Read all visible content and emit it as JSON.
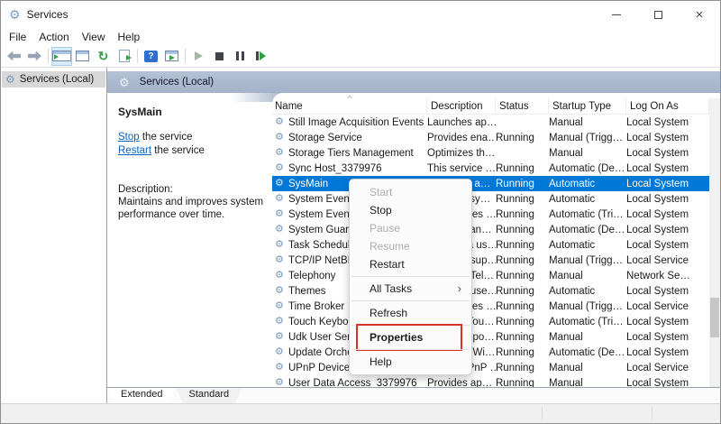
{
  "window": {
    "title": "Services"
  },
  "menubar": {
    "items": [
      "File",
      "Action",
      "View",
      "Help"
    ]
  },
  "toolbar": {
    "icons": [
      "back",
      "forward",
      "show-console-tree",
      "properties-window",
      "refresh",
      "export-list",
      "help",
      "show-extended-view",
      "start-service",
      "stop-service",
      "pause-service",
      "restart-service"
    ]
  },
  "tree": {
    "root_label": "Services (Local)"
  },
  "extended_panel": {
    "header": "Services (Local)",
    "service_name": "SysMain",
    "links": [
      {
        "action": "Stop",
        "rest": " the service"
      },
      {
        "action": "Restart",
        "rest": " the service"
      }
    ],
    "description_label": "Description:",
    "description": "Maintains and improves system performance over time."
  },
  "services_list": {
    "columns": [
      "Name",
      "Description",
      "Status",
      "Startup Type",
      "Log On As"
    ],
    "sort_indicator": "^",
    "rows": [
      {
        "name": "Still Image Acquisition Events",
        "description": "Launches ap…",
        "status": "",
        "startup": "Manual",
        "logon": "Local System"
      },
      {
        "name": "Storage Service",
        "description": "Provides ena…",
        "status": "Running",
        "startup": "Manual (Trigg…",
        "logon": "Local System"
      },
      {
        "name": "Storage Tiers Management",
        "description": "Optimizes th…",
        "status": "",
        "startup": "Manual",
        "logon": "Local System"
      },
      {
        "name": "Sync Host_3379976",
        "description": "This service …",
        "status": "Running",
        "startup": "Automatic (De…",
        "logon": "Local System"
      },
      {
        "name": "SysMain",
        "description": "Maintains a…",
        "status": "Running",
        "startup": "Automatic",
        "logon": "Local System",
        "selected": true
      },
      {
        "name": "System Event Notification S…",
        "description": "Monitors sy…",
        "status": "Running",
        "startup": "Automatic",
        "logon": "Local System"
      },
      {
        "name": "System Events Broker",
        "description": "Coordinates …",
        "status": "Running",
        "startup": "Automatic (Tri…",
        "logon": "Local System"
      },
      {
        "name": "System Guard Runtime Mon…",
        "description": "Monitors an…",
        "status": "Running",
        "startup": "Automatic (De…",
        "logon": "Local System"
      },
      {
        "name": "Task Scheduler",
        "description": "Enables a us…",
        "status": "Running",
        "startup": "Automatic",
        "logon": "Local System"
      },
      {
        "name": "TCP/IP NetBIOS Helper",
        "description": "Provides sup…",
        "status": "Running",
        "startup": "Manual (Trigg…",
        "logon": "Local Service"
      },
      {
        "name": "Telephony",
        "description": "Provides Tel…",
        "status": "Running",
        "startup": "Manual",
        "logon": "Network Se…"
      },
      {
        "name": "Themes",
        "description": "Provides use…",
        "status": "Running",
        "startup": "Automatic",
        "logon": "Local System"
      },
      {
        "name": "Time Broker",
        "description": "Coordinates …",
        "status": "Running",
        "startup": "Manual (Trigg…",
        "logon": "Local Service"
      },
      {
        "name": "Touch Keyboard and Handw…",
        "description": "Enables Tou…",
        "status": "Running",
        "startup": "Automatic (Tri…",
        "logon": "Local System"
      },
      {
        "name": "Udk User Service_3379976",
        "description": "Shell compo…",
        "status": "Running",
        "startup": "Manual",
        "logon": "Local System"
      },
      {
        "name": "Update Orchestrator Service",
        "description": "Manages Wi…",
        "status": "Running",
        "startup": "Automatic (De…",
        "logon": "Local System"
      },
      {
        "name": "UPnP Device Host",
        "description": "Allows UPnP …",
        "status": "Running",
        "startup": "Manual",
        "logon": "Local Service"
      },
      {
        "name": "User Data Access_3379976",
        "description": "Provides ap…",
        "status": "Running",
        "startup": "Manual",
        "logon": "Local System"
      }
    ]
  },
  "context_menu": {
    "items": [
      {
        "label": "Start",
        "disabled": true
      },
      {
        "label": "Stop"
      },
      {
        "label": "Pause",
        "disabled": true
      },
      {
        "label": "Resume",
        "disabled": true
      },
      {
        "label": "Restart"
      },
      {
        "separator": true
      },
      {
        "label": "All Tasks",
        "submenu": true
      },
      {
        "separator": true
      },
      {
        "label": "Refresh"
      },
      {
        "separator": true
      },
      {
        "label": "Properties",
        "bold": true,
        "annotated": true
      },
      {
        "separator": true
      },
      {
        "label": "Help"
      }
    ]
  },
  "tabs": {
    "items": [
      "Extended",
      "Standard"
    ],
    "active": "Extended"
  },
  "colors": {
    "selection": "#0078d7",
    "panel_header": "#a7b5ca",
    "link": "#0563c1",
    "annotation_red": "#d93025"
  }
}
